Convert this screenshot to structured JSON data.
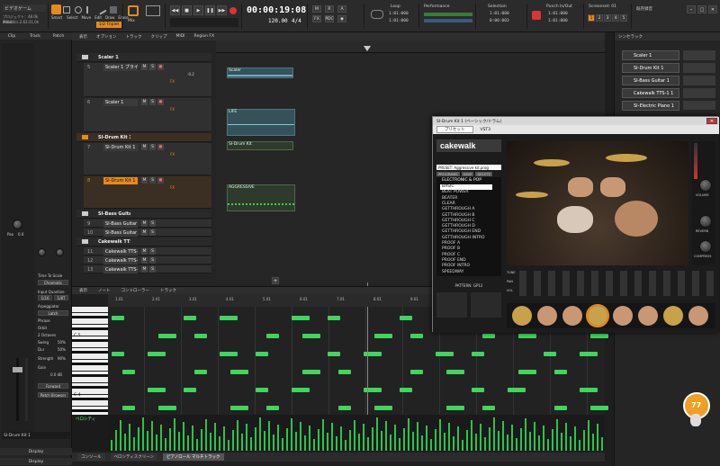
{
  "control_bar": {
    "project_title": "ビデオゲーム",
    "project_line1": "プロジェクト：48.0k 24bit",
    "project_line2": "Melodics 2.63:31.0k",
    "tools": [
      "Smart",
      "Select",
      "Move",
      "Edit",
      "Draw",
      "Erase"
    ],
    "snap_value": "1/2 Triplet",
    "mix_label": "Mix",
    "transport_time": "00:00:19:08",
    "tempo": "120.00",
    "meter": "4/4",
    "loop_label": "Loop",
    "loop_start": "1:01:000",
    "loop_end": "1:01:000",
    "performance_label": "Performance",
    "selection_label": "Selection",
    "selection_start": "1:01:000",
    "selection_end": "0:00:003",
    "punch_label": "Punch In/Out",
    "punch_start": "1:01:000",
    "punch_end": "1:01:000",
    "screenset_label": "Screenset: 01",
    "screenset_slots": [
      "1",
      "2",
      "3",
      "4",
      "5"
    ],
    "right_label": "既存録音"
  },
  "inspector": {
    "tabs": [
      "Clip",
      "Track",
      "Patch"
    ],
    "pan_label": "Pan",
    "pan_value": "0.0",
    "time_to_scale": "Time To Scale",
    "chromatic_label": "Chromatic",
    "input_quantize_label": "Input Quantize",
    "quantize_values": [
      "1/16",
      "1/8T"
    ],
    "arpeggiator_label": "Arpeggiator",
    "latch_label": "Latch",
    "rows": [
      "Phrase",
      "Orbit",
      "2 Octaves",
      "Swing",
      "Dur"
    ],
    "percent_values": [
      "50%",
      "50%",
      "90%"
    ],
    "strength_label": "Strength",
    "gain_label": "Gain",
    "db_value": "0.0 dB",
    "forward_label": "Forward",
    "patch_browser": "Patch Browser",
    "track_name": "SI-Drum Kit 1",
    "bottom_tabs": [
      "Display",
      "Display"
    ]
  },
  "track_view": {
    "header_menus": [
      "表示",
      "オプション",
      "トラック",
      "クリップ",
      "MIDI",
      "Region FX"
    ],
    "tracks": [
      {
        "num": "",
        "name": "Scaler 1",
        "folder": true
      },
      {
        "num": "5",
        "name": "Scaler 1 プライマリ",
        "folder": false,
        "volume": "-0.2",
        "fx": "FX"
      },
      {
        "num": "6",
        "name": "Scaler 1",
        "folder": false,
        "fx": "FX"
      },
      {
        "num": "",
        "name": "SI-Drum Kit 1",
        "folder": true
      },
      {
        "num": "7",
        "name": "SI-Drum Kit 1",
        "folder": false,
        "fx": "FX"
      },
      {
        "num": "8",
        "name": "SI-Drum Kit 1",
        "folder": false,
        "fx": "FX"
      },
      {
        "num": "",
        "name": "SI-Bass Guitar",
        "folder": true
      },
      {
        "num": "9",
        "name": "SI-Bass Guitar",
        "folder": false
      },
      {
        "num": "10",
        "name": "SI-Bass Guitar",
        "folder": false
      },
      {
        "num": "",
        "name": "Cakewalk TTS-1",
        "folder": true
      },
      {
        "num": "11",
        "name": "Cakewalk TTS-1",
        "folder": false
      },
      {
        "num": "12",
        "name": "Cakewalk TTS-1",
        "folder": false
      },
      {
        "num": "13",
        "name": "Cakewalk TTS-1",
        "folder": false
      }
    ],
    "clips": [
      {
        "name": "Scaler"
      },
      {
        "name": "LIFE"
      },
      {
        "name": "SI-Drum Kit"
      },
      {
        "name": "AGGRESSIVE"
      }
    ],
    "add_track_symbol": "+"
  },
  "piano_roll": {
    "menus": [
      "表示",
      "ノート",
      "コントローラー",
      "トラック"
    ],
    "ruler": [
      "1.01",
      "2.01",
      "3.01",
      "4.01",
      "5.01",
      "6.01",
      "7.01",
      "8.01",
      "9.01",
      "10.01"
    ],
    "key_labels": [
      "C 5",
      "C 4"
    ],
    "velocity_label": "ベロシティ",
    "bottom_tabs": [
      "コンソール",
      "ベロシティスクリーン",
      "ピアノロール マルチトラック"
    ],
    "badge": "77"
  },
  "plugin": {
    "title": "SI-Drum Kit 1 (ベーシック/ドラム)",
    "preset_dropdown": "プリセット",
    "vst_label": "VST3",
    "brand": "cakewalk",
    "current_preset": "PRESET: Aggressive kit.prog",
    "preset_tabs": [
      "PROGRAMS",
      "SAVE",
      "DELETE"
    ],
    "category": "ELECTRONIC & POP",
    "presets": [
      "BASIC",
      "BEAT POWER",
      "BEATER",
      "CLEAR",
      "GETTHROUGH A",
      "GETTHROUGH B",
      "GETTHROUGH C",
      "GETTHROUGH D",
      "GETTHROUGH END",
      "GETTHROUGH INTRO",
      "PROOF A",
      "PROOF B",
      "PROOF C",
      "PROOF END",
      "PROOF INTRO",
      "SPEEDWAY"
    ],
    "pattern_label": "PATTERN: GP12",
    "knob_labels": {
      "volume": "VOLUME",
      "reverb": "REVERB",
      "compress": "COMPRESS"
    },
    "row_labels": [
      "TUNE",
      "PAN",
      "VOL"
    ]
  },
  "browser": {
    "title": "シンセラック",
    "items": [
      "Scaler 1",
      "SI-Drum Kit 1",
      "SI-Bass Guitar 1",
      "Cakewalk TTS-1 1",
      "SI-Electric Piano 1"
    ]
  },
  "colors": {
    "accent_orange": "#e88a1a",
    "note_green": "#3fd65c",
    "clip_teal": "#35525a",
    "record_red": "#d33"
  }
}
